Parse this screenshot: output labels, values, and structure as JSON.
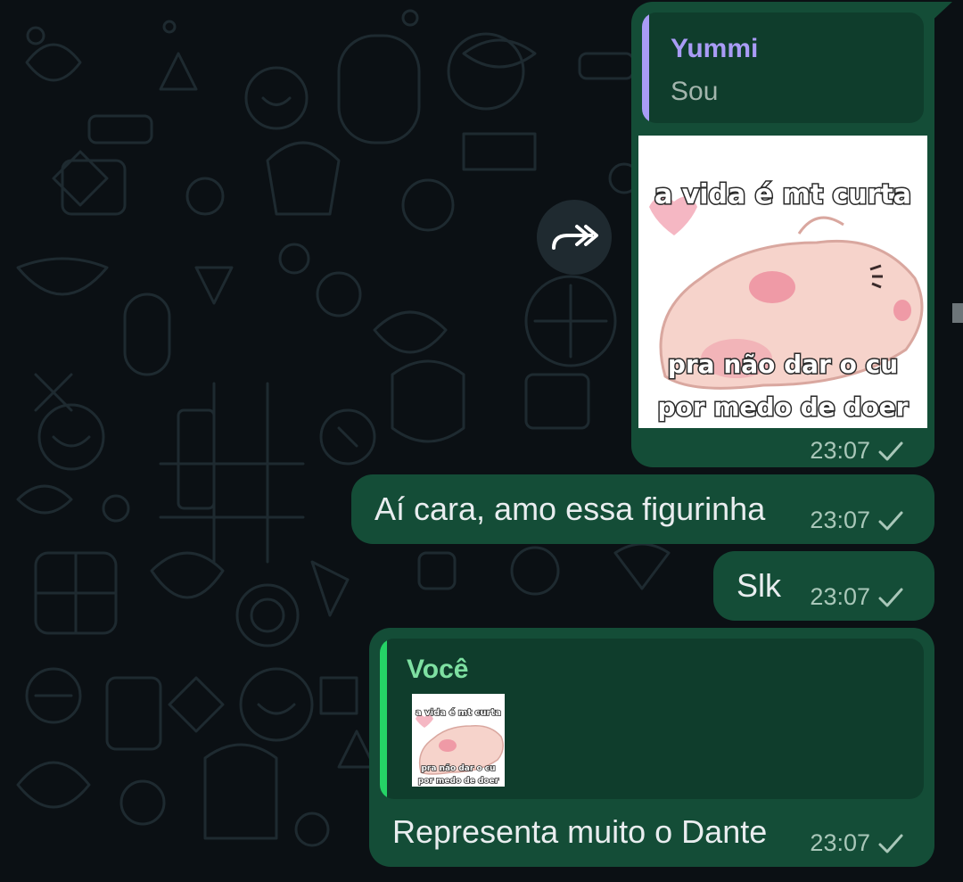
{
  "colors": {
    "bubble_out": "#144d37",
    "quote_bg": "#0f3d2c",
    "yummi_accent": "#a99cf6",
    "voce_accent": "#25d366",
    "voce_name": "#7ee0a2"
  },
  "forward_button": {
    "icon": "forward-arrows-icon"
  },
  "messages": [
    {
      "reply": {
        "author": "Yummi",
        "text": "Sou"
      },
      "sticker": {
        "line1": "a vida é mt curta",
        "line2": "pra não dar o cu",
        "line3": "por medo de doer"
      },
      "time": "23:07",
      "status_icon": "single-check-icon"
    },
    {
      "text": "Aí cara, amo essa figurinha",
      "time": "23:07",
      "status_icon": "single-check-icon"
    },
    {
      "text": "Slk",
      "time": "23:07",
      "status_icon": "single-check-icon"
    },
    {
      "reply": {
        "author": "Você",
        "sticker_thumb": {
          "line1": "a vida é mt curta",
          "line2": "pra não dar o cu",
          "line3": "por medo de doer"
        }
      },
      "text": "Representa muito o Dante",
      "time": "23:07",
      "status_icon": "single-check-icon"
    }
  ]
}
